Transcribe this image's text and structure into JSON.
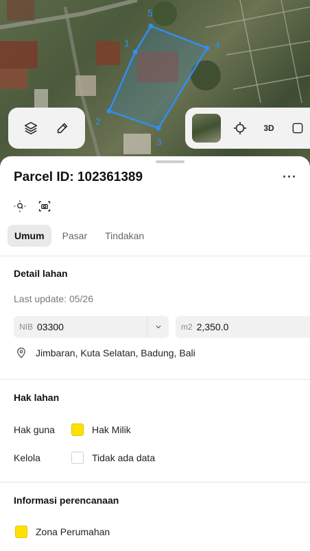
{
  "map": {
    "vertex_labels": [
      "1",
      "2",
      "3",
      "4",
      "5"
    ],
    "accent_color": "#2f8ff0",
    "controls_left": [
      {
        "icon": "layers-icon"
      },
      {
        "icon": "draw-icon"
      }
    ],
    "controls_right": [
      {
        "icon": "satellite-thumbnail"
      },
      {
        "icon": "crosshair-icon"
      },
      {
        "label": "3D"
      },
      {
        "icon": "fullscreen-icon"
      }
    ]
  },
  "sheet": {
    "title": "Parcel ID: 102361389",
    "more": "···",
    "tools": [
      "zoom-to-parcel-icon",
      "screenshot-icon"
    ],
    "tabs": [
      "Umum",
      "Pasar",
      "Tindakan"
    ],
    "active_tab": "Umum"
  },
  "detail": {
    "heading": "Detail lahan",
    "last_update": "Last update: 05/26",
    "nib_prefix": "NIB",
    "nib_value": "03300",
    "area_prefix": "m2",
    "area_value": "2,350.0",
    "location": "Jimbaran, Kuta Selatan, Badung, Bali"
  },
  "rights": {
    "heading": "Hak lahan",
    "rows": [
      {
        "label": "Hak guna",
        "value": "Hak Milik",
        "swatch": "#ffe100"
      },
      {
        "label": "Kelola",
        "value": "Tidak ada data",
        "swatch": "#ffffff"
      }
    ]
  },
  "planning": {
    "heading": "Informasi perencanaan",
    "zones": [
      {
        "label": "Zona Perumahan",
        "swatch": "#ffe100"
      }
    ]
  }
}
